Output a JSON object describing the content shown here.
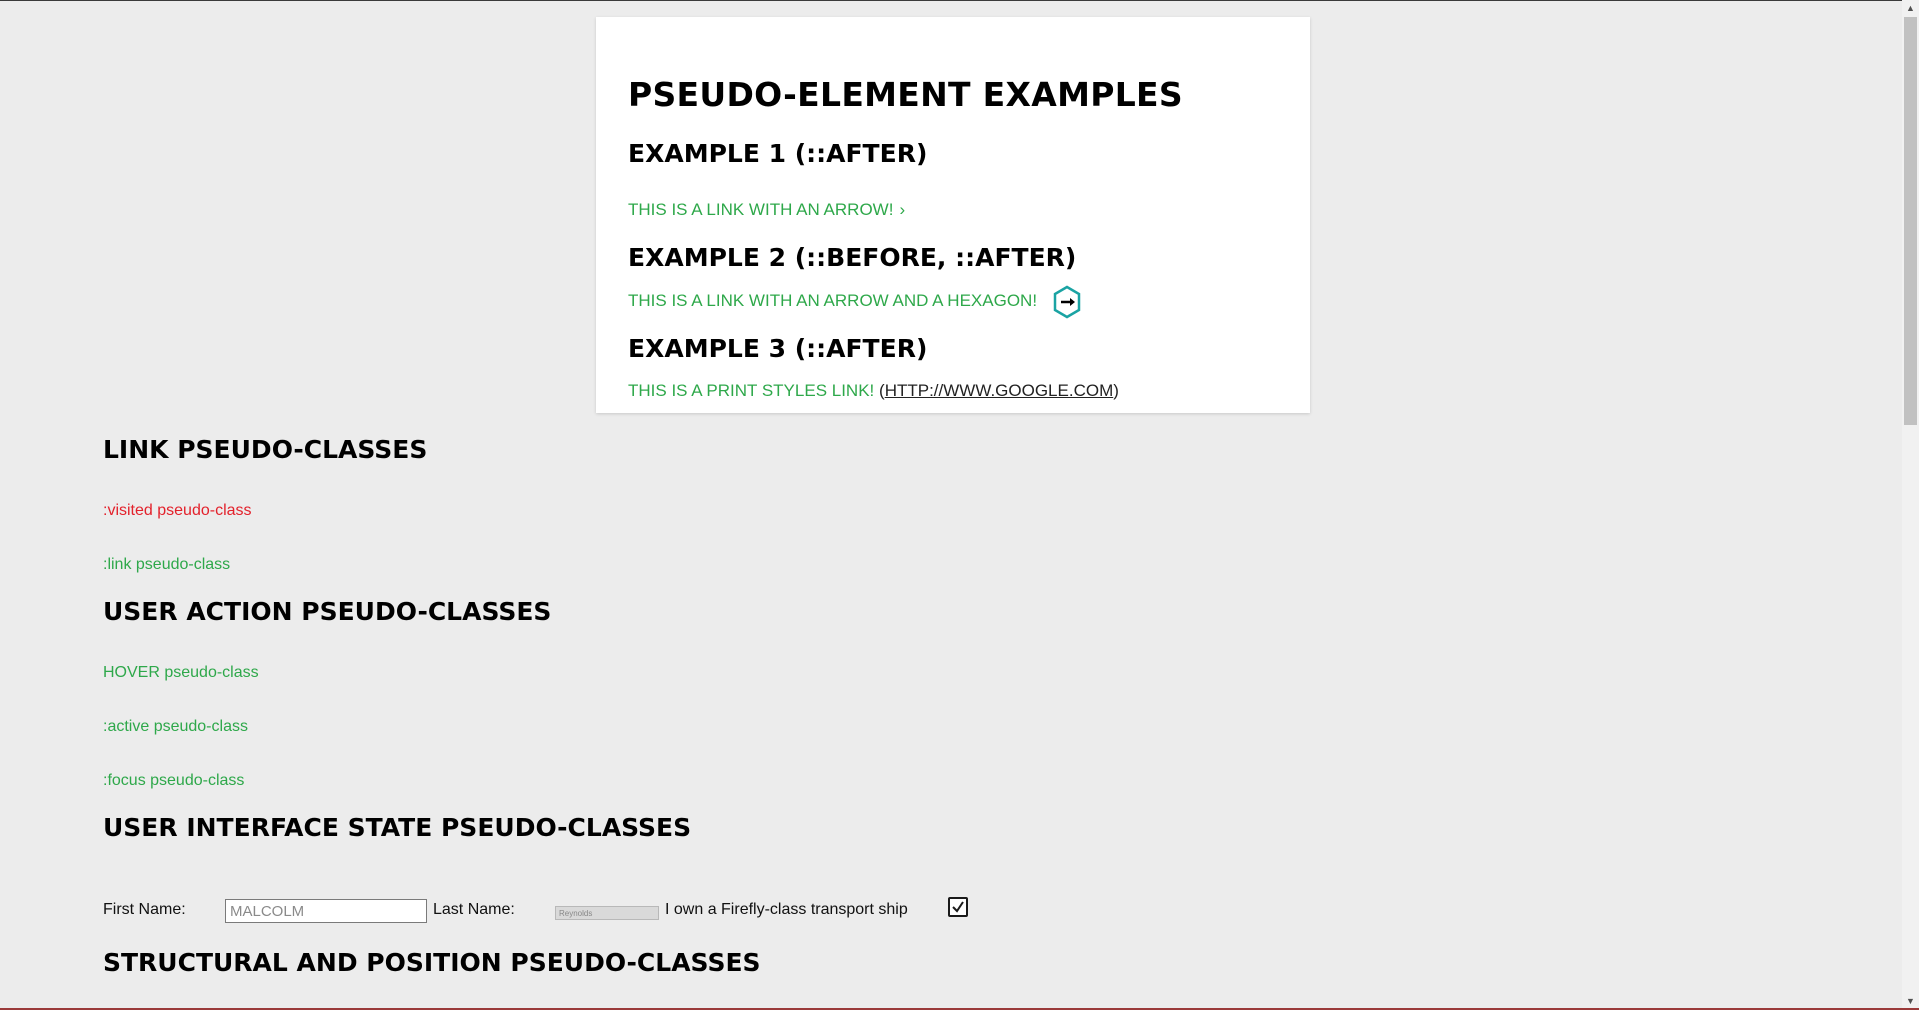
{
  "card": {
    "title": "PSEUDO-ELEMENT EXAMPLES",
    "example1": {
      "heading": "EXAMPLE 1 (::AFTER)",
      "link": "THIS IS A LINK WITH AN ARROW!",
      "after": "›"
    },
    "example2": {
      "heading": "EXAMPLE 2 (::BEFORE, ::AFTER)",
      "link": "THIS IS A LINK WITH AN ARROW AND A HEXAGON!"
    },
    "example3": {
      "heading": "EXAMPLE 3 (::AFTER)",
      "link": "THIS IS A PRINT STYLES LINK!",
      "url_open": "(",
      "url": "HTTP://WWW.GOOGLE.COM",
      "url_close": ")"
    },
    "accent_color": "#2ea84a",
    "hexagon_color": "#1aa3a3"
  },
  "link_section": {
    "heading": "LINK PSEUDO-CLASSES",
    "visited": ":visited pseudo-class",
    "link": ":link pseudo-class",
    "visited_color": "#e3212b"
  },
  "user_action_section": {
    "heading": "USER ACTION PSEUDO-CLASSES",
    "hover": "HOVER pseudo-class",
    "active": ":active pseudo-class",
    "focus": ":focus pseudo-class"
  },
  "ui_state_section": {
    "heading": "USER INTERFACE STATE PSEUDO-CLASSES",
    "first_name_label": "First Name:",
    "first_name_value": "MALCOLM",
    "last_name_label": "Last Name:",
    "last_name_value": "Reynolds",
    "checkbox_label": "I own a Firefly-class transport ship",
    "checkbox_checked": true
  },
  "structural_section": {
    "heading": "STRUCTURAL AND POSITION PSEUDO-CLASSES"
  },
  "scrollbar": {
    "up_icon": "chevron-up-icon",
    "down_icon": "chevron-down-icon"
  }
}
